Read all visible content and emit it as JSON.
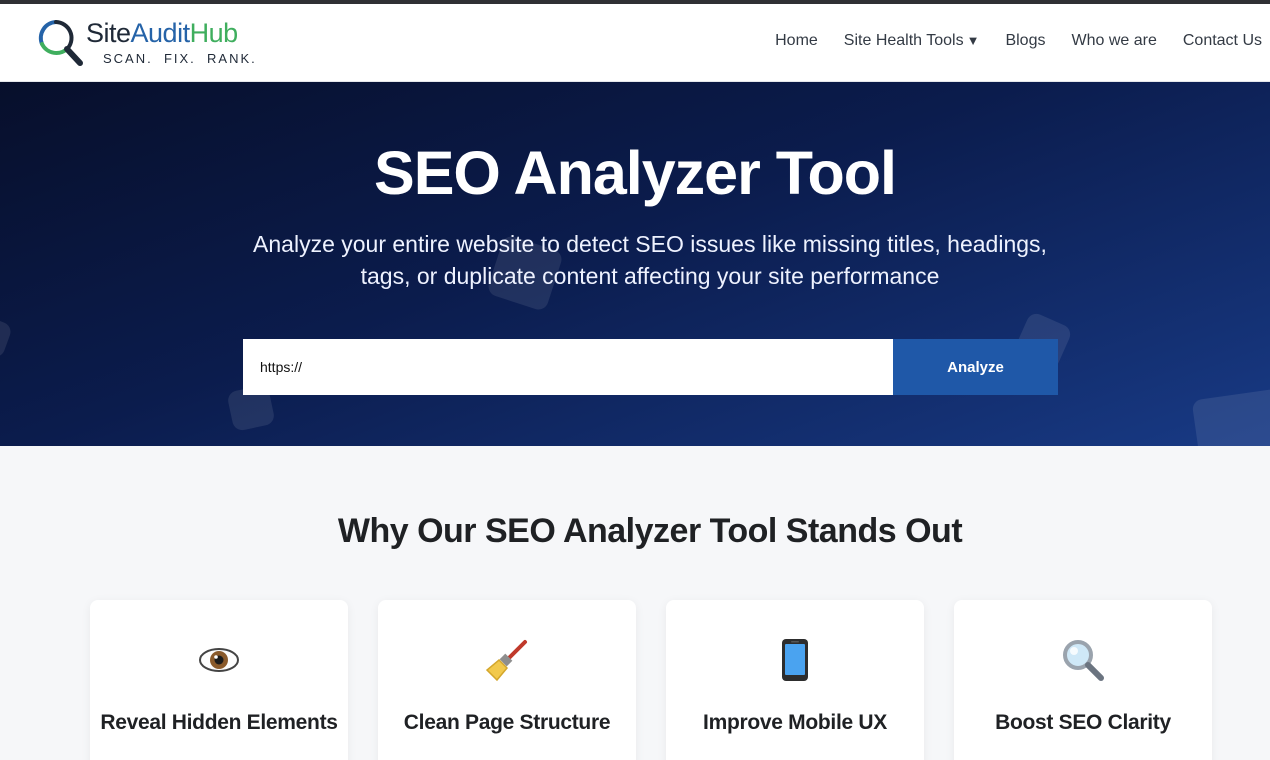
{
  "brand": {
    "name_part1": "Site",
    "name_part2": "Audit",
    "name_part3": "Hub",
    "tagline": "SCAN.  FIX.  RANK.",
    "colors": {
      "dark": "#1f2937",
      "blue": "#2563a8",
      "green": "#3fae5e"
    }
  },
  "nav": {
    "items": [
      "Home",
      "Site Health Tools",
      "Blogs",
      "Who we are",
      "Contact Us"
    ],
    "dropdown_caret": "▼"
  },
  "hero": {
    "title": "SEO Analyzer Tool",
    "subtitle": "Analyze your entire website to detect SEO issues like missing titles, headings, tags, or duplicate content affecting your site performance",
    "input_value": "https://",
    "button_label": "Analyze",
    "colors": {
      "background_dark": "#070f2b",
      "background_light": "#183a85",
      "button": "#1f58a8"
    }
  },
  "features": {
    "heading": "Why Our SEO Analyzer Tool Stands Out",
    "cards": [
      {
        "icon": "eye-icon",
        "title": "Reveal Hidden Elements",
        "desc": ""
      },
      {
        "icon": "broom-icon",
        "title": "Clean Page Structure",
        "desc": ""
      },
      {
        "icon": "mobile-phone-icon",
        "title": "Improve Mobile UX",
        "desc": ""
      },
      {
        "icon": "magnifier-icon",
        "title": "Boost SEO Clarity",
        "desc": ""
      }
    ]
  }
}
